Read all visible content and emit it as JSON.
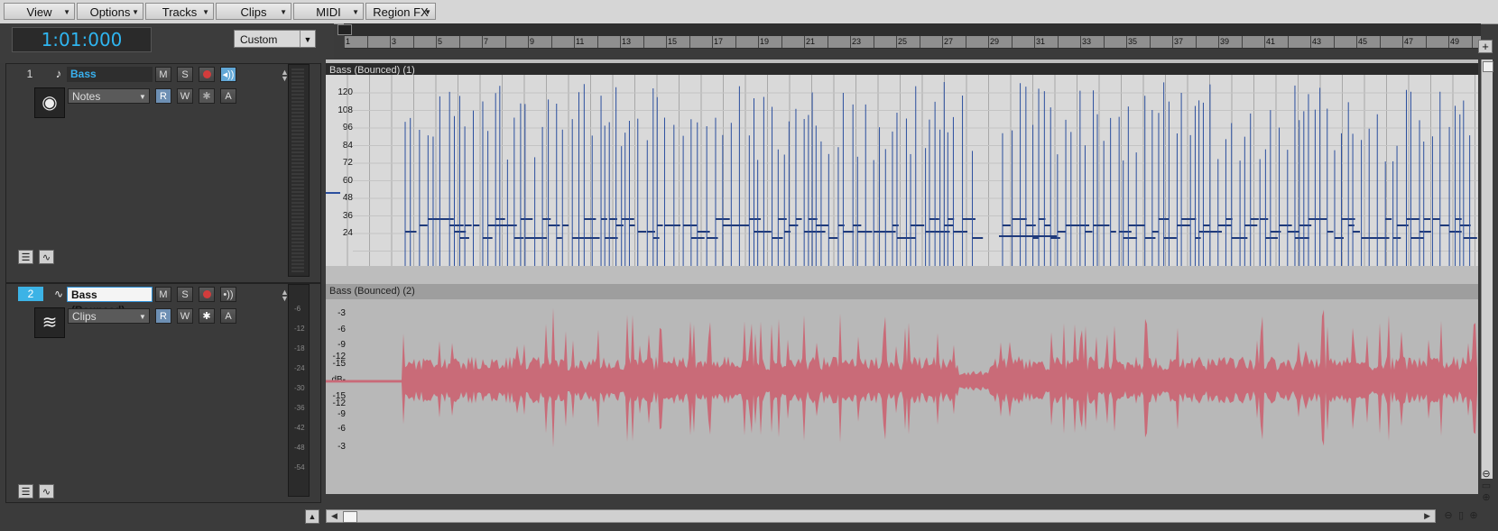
{
  "menu": {
    "items": [
      {
        "label": "View"
      },
      {
        "label": "Options"
      },
      {
        "label": "Tracks"
      },
      {
        "label": "Clips"
      },
      {
        "label": "MIDI"
      },
      {
        "label": "Region FX"
      }
    ]
  },
  "transport": {
    "time": "1:01:000",
    "layout_value": "Custom"
  },
  "ruler": {
    "bars": [
      "1",
      "3",
      "5",
      "7",
      "9",
      "11",
      "13",
      "15",
      "17",
      "19",
      "21",
      "23",
      "25",
      "27",
      "29",
      "31",
      "33",
      "35",
      "37",
      "39",
      "41",
      "43",
      "45",
      "47",
      "49"
    ]
  },
  "tracks": [
    {
      "number": "1",
      "name": "Bass",
      "mode": "Notes",
      "mute_label": "M",
      "solo_label": "S",
      "read_label": "R",
      "write_label": "W",
      "arm_label": "A",
      "clip_title": "Bass (Bounced) (1)",
      "scale": [
        "120",
        "108",
        "96",
        "84",
        "72",
        "60",
        "48",
        "36",
        "24"
      ]
    },
    {
      "number": "2",
      "name": "Bass (Bounced)",
      "mode": "Clips",
      "mute_label": "M",
      "solo_label": "S",
      "read_label": "R",
      "write_label": "W",
      "arm_label": "A",
      "clip_title": "Bass (Bounced) (2)",
      "scale": [
        "-3",
        "-6",
        "-9",
        "-12",
        "-15",
        "dB-",
        "-15",
        "-12",
        "-9",
        "-6",
        "-3"
      ],
      "meter_scale": [
        "-6",
        "-12",
        "-18",
        "-24",
        "-30",
        "-36",
        "-42",
        "-48",
        "-54"
      ]
    }
  ],
  "colors": {
    "accent": "#2fb5f0",
    "midi_notes": "#2b4f9e",
    "audio_wave": "#c96b78",
    "record": "#d23c3c"
  }
}
